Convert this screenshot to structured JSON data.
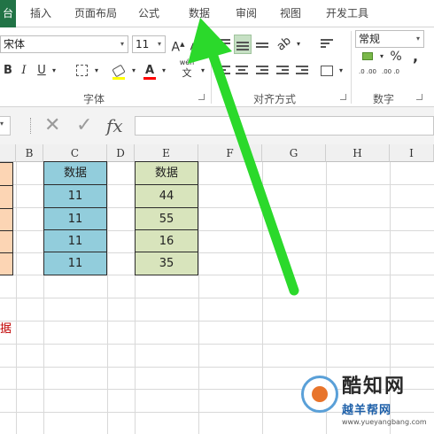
{
  "tabs": [
    "台",
    "插入",
    "页面布局",
    "公式",
    "数据",
    "审阅",
    "视图",
    "开发工具"
  ],
  "ribbon": {
    "font_name": "宋体",
    "font_size": "11",
    "grow_font": "A",
    "shrink_font": "A",
    "bold": "B",
    "italic": "I",
    "underline": "U",
    "font_color_glyph": "A",
    "phonetic_top": "wén",
    "phonetic_bottom": "文",
    "group_font": "字体",
    "group_align": "对齐方式",
    "group_number": "数字",
    "number_format": "常规",
    "percent": "%",
    "comma": ",",
    "dec_inc": ".0 .00",
    "dec_dec": ".00 .0",
    "dropdown": "▾"
  },
  "formula_bar": {
    "cancel": "✕",
    "confirm": "✓",
    "fx": "fx",
    "value": ""
  },
  "columns": [
    "B",
    "C",
    "D",
    "E",
    "F",
    "G",
    "H",
    "I"
  ],
  "column_c": {
    "header": "数据",
    "values": [
      "11",
      "11",
      "11",
      "11"
    ]
  },
  "column_e": {
    "header": "数据",
    "values": [
      "44",
      "55",
      "16",
      "35"
    ]
  },
  "cut_text": "据",
  "colors": {
    "tab_active": "#217346",
    "col_c_fill": "#92cddc",
    "col_e_fill": "#d8e4bc",
    "col_a_fill": "#fcd5b4",
    "arrow": "#2bd92b",
    "red_text": "#c00000"
  },
  "watermark": {
    "brand": "酷知网",
    "subtitle": "越羊帮网",
    "url": "www.yueyangbang.com"
  }
}
